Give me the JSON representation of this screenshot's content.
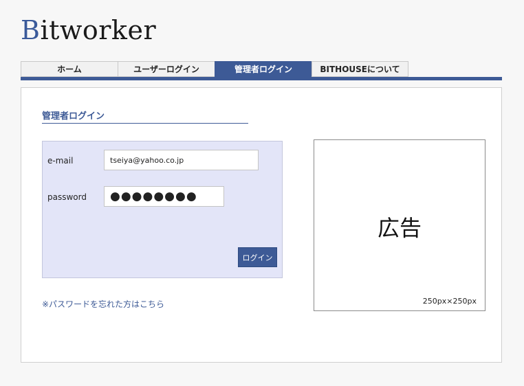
{
  "logo": {
    "initial": "B",
    "rest": "itworker"
  },
  "nav": {
    "tabs": [
      {
        "label": "ホーム",
        "active": false
      },
      {
        "label": "ユーザーログイン",
        "active": false
      },
      {
        "label": "管理者ログイン",
        "active": true
      },
      {
        "label": "BITHOUSEについて",
        "active": false
      }
    ]
  },
  "login": {
    "title": "管理者ログイン",
    "email_label": "e-mail",
    "email_value": "tseiya@yahoo.co.jp",
    "password_label": "password",
    "password_mask": "●●●●●●●●",
    "submit_label": "ログイン",
    "forgot_link": "※パスワードを忘れた方はこちら"
  },
  "ad": {
    "label": "広告",
    "size": "250px×250px"
  },
  "colors": {
    "accent": "#3d5a96",
    "login_box_bg": "#e3e5f8"
  }
}
